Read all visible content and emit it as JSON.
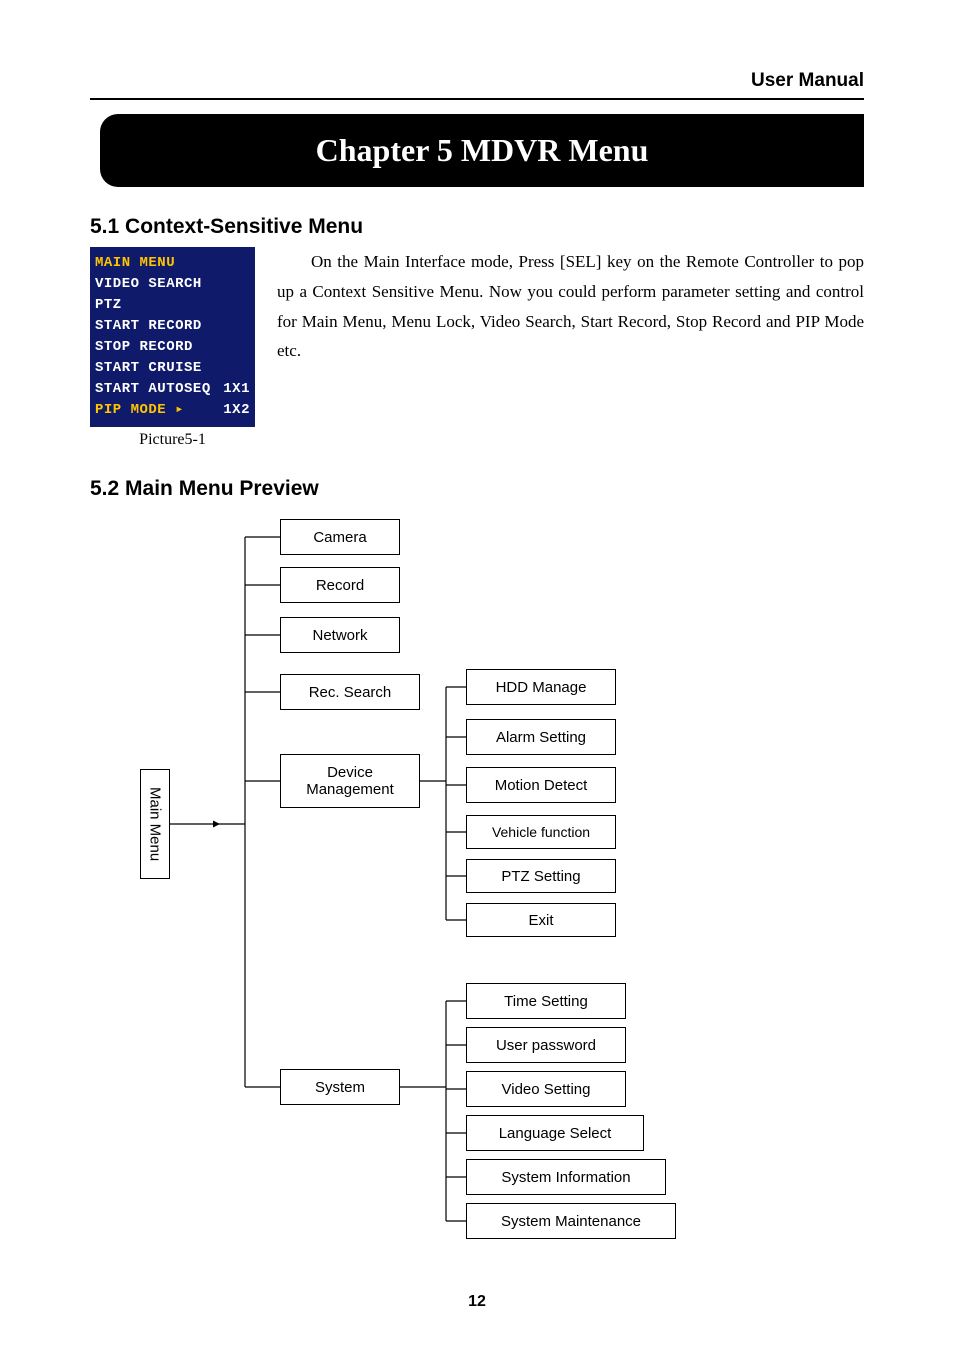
{
  "header": {
    "right": "User Manual"
  },
  "chapter": {
    "title": "Chapter 5 MDVR Menu"
  },
  "section51": {
    "heading": "5.1 Context-Sensitive Menu",
    "caption": "Picture5-1",
    "menu": {
      "items": [
        {
          "label": "MAIN MENU",
          "active": true
        },
        {
          "label": "VIDEO SEARCH"
        },
        {
          "label": "PTZ"
        },
        {
          "label": "START RECORD"
        },
        {
          "label": "STOP RECORD"
        },
        {
          "label": "START CRUISE"
        },
        {
          "label": "START AUTOSEQ",
          "right": "1X1"
        },
        {
          "label": "PIP MODE",
          "active": true,
          "arrow": true,
          "right": "1X2"
        }
      ]
    },
    "paragraph": "On the Main Interface mode, Press [SEL] key on the Remote Controller to pop up a Context Sensitive Menu. Now you could perform parameter setting and control for Main Menu, Menu Lock, Video Search, Start Record, Stop Record and PIP Mode etc."
  },
  "section52": {
    "heading": "5.2 Main Menu Preview",
    "root": "Main Menu",
    "level1": [
      {
        "key": "camera",
        "label": "Camera"
      },
      {
        "key": "record",
        "label": "Record"
      },
      {
        "key": "network",
        "label": "Network"
      },
      {
        "key": "recsearch",
        "label": "Rec. Search"
      },
      {
        "key": "device",
        "label": "Device Management"
      },
      {
        "key": "system",
        "label": "System"
      }
    ],
    "device_children": [
      "HDD Manage",
      "Alarm Setting",
      "Motion Detect",
      "Vehicle function",
      "PTZ Setting",
      "Exit"
    ],
    "system_children": [
      "Time Setting",
      "User password",
      "Video Setting",
      "Language Select",
      "System Information",
      "System Maintenance"
    ]
  },
  "page_number": "12"
}
